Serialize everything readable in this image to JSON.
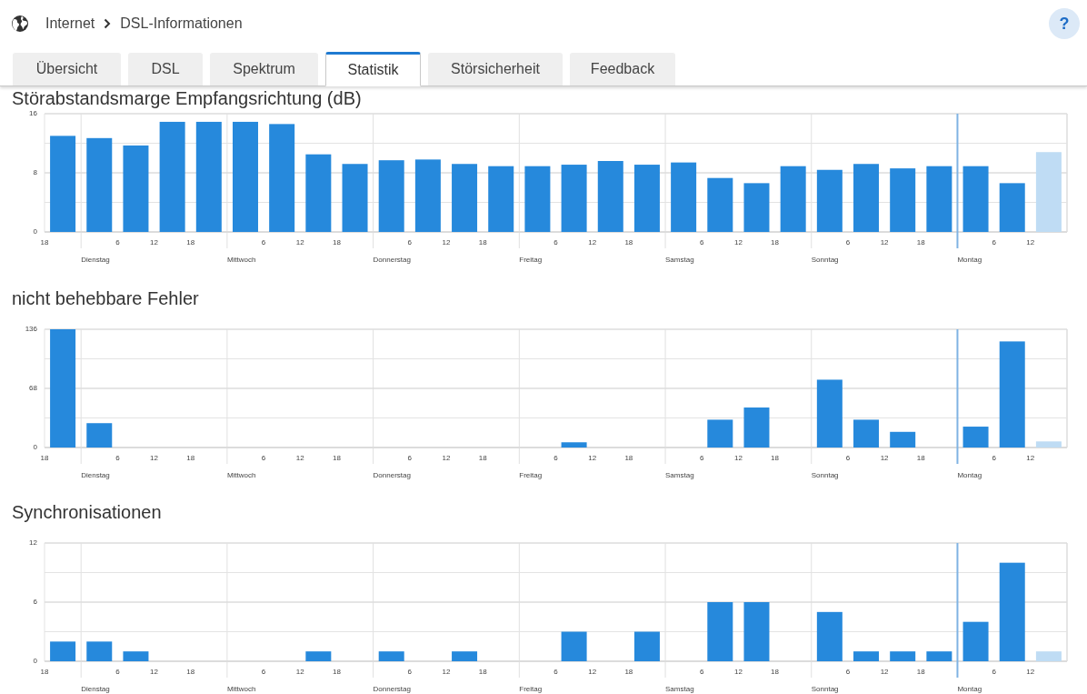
{
  "breadcrumb": [
    "Internet",
    "DSL-Informationen"
  ],
  "help": {
    "label": "?"
  },
  "tabs": [
    {
      "label": "Übersicht",
      "selected": false
    },
    {
      "label": "DSL",
      "selected": false
    },
    {
      "label": "Spektrum",
      "selected": false
    },
    {
      "label": "Statistik",
      "selected": true
    },
    {
      "label": "Störsicherheit",
      "selected": false
    },
    {
      "label": "Feedback",
      "selected": false
    }
  ],
  "charts": [
    {
      "title": "Störabstandsmarge Empfangsrichtung (dB)",
      "x_axis": {
        "hours": [
          "18",
          "6",
          "12",
          "18",
          "6",
          "12",
          "18",
          "6",
          "12",
          "18",
          "6",
          "12",
          "18",
          "6",
          "12",
          "18",
          "6",
          "12",
          "18",
          "6",
          "12"
        ],
        "days": [
          "Dienstag",
          "Mittwoch",
          "Donnerstag",
          "Freitag",
          "Samstag",
          "Sonntag",
          "Montag"
        ]
      },
      "chart_data": {
        "type": "bar",
        "stacked": true,
        "categories": [
          null,
          null,
          null,
          null,
          null,
          null,
          null,
          null,
          null,
          null,
          null,
          null,
          null,
          null,
          null,
          null,
          null,
          null,
          null,
          null,
          null,
          null,
          null,
          null,
          null,
          null,
          null,
          null
        ],
        "series": [
          {
            "color": "#2689dc",
            "values": [
              13.0,
              12.7,
              11.7,
              14.9,
              14.9,
              14.9,
              14.6,
              10.5,
              9.2,
              9.7,
              9.8,
              9.2,
              8.9,
              8.9,
              9.1,
              9.6,
              9.1,
              9.4,
              7.3,
              6.6,
              8.9,
              8.4,
              9.2,
              8.6,
              8.9,
              8.9,
              6.6,
              null
            ]
          },
          {
            "color": "#bfdcf4",
            "values": [
              null,
              null,
              null,
              null,
              null,
              null,
              null,
              null,
              null,
              null,
              null,
              null,
              null,
              null,
              null,
              null,
              null,
              null,
              null,
              null,
              null,
              null,
              null,
              null,
              null,
              null,
              null,
              10.8
            ]
          }
        ],
        "ylim": [
          0,
          16
        ],
        "yticks": [
          0,
          8,
          16
        ],
        "ref_lines": [
          {
            "axis": "y",
            "value": 4
          },
          {
            "axis": "y",
            "value": 8
          },
          {
            "axis": "y",
            "value": 12
          }
        ]
      }
    },
    {
      "title": "nicht behebbare Fehler",
      "x_axis": {
        "hours": [
          "18",
          "6",
          "12",
          "18",
          "6",
          "12",
          "18",
          "6",
          "12",
          "18",
          "6",
          "12",
          "18",
          "6",
          "12",
          "18",
          "6",
          "12",
          "18",
          "6",
          "12"
        ],
        "days": [
          "Dienstag",
          "Mittwoch",
          "Donnerstag",
          "Freitag",
          "Samstag",
          "Sonntag",
          "Montag"
        ]
      },
      "chart_data": {
        "type": "bar",
        "stacked": true,
        "categories": [
          null,
          null,
          null,
          null,
          null,
          null,
          null,
          null,
          null,
          null,
          null,
          null,
          null,
          null,
          null,
          null,
          null,
          null,
          null,
          null,
          null,
          null,
          null,
          null,
          null,
          null,
          null,
          null
        ],
        "series": [
          {
            "color": "#2689dc",
            "values": [
              136,
              28,
              0,
              0,
              0,
              0,
              0,
              0,
              0,
              0,
              0,
              0,
              0,
              0,
              6,
              0,
              0,
              0,
              32,
              46,
              0,
              78,
              32,
              18,
              0,
              24,
              122,
              null
            ]
          },
          {
            "color": "#bfdcf4",
            "values": [
              null,
              null,
              null,
              null,
              null,
              null,
              null,
              null,
              null,
              null,
              null,
              null,
              null,
              null,
              null,
              null,
              null,
              null,
              null,
              null,
              null,
              null,
              null,
              null,
              null,
              null,
              null,
              7
            ]
          }
        ],
        "ylim": [
          0,
          136
        ],
        "yticks": [
          0,
          68,
          136
        ],
        "ref_lines": [
          {
            "axis": "y",
            "value": 34
          },
          {
            "axis": "y",
            "value": 68
          },
          {
            "axis": "y",
            "value": 102
          }
        ]
      }
    },
    {
      "title": "Synchronisationen",
      "x_axis": {
        "hours": [
          "18",
          "6",
          "12",
          "18",
          "6",
          "12",
          "18",
          "6",
          "12",
          "18",
          "6",
          "12",
          "18",
          "6",
          "12",
          "18",
          "6",
          "12",
          "18",
          "6",
          "12"
        ],
        "days": [
          "Dienstag",
          "Mittwoch",
          "Donnerstag",
          "Freitag",
          "Samstag",
          "Sonntag",
          "Montag"
        ]
      },
      "chart_data": {
        "type": "bar",
        "stacked": true,
        "categories": [
          null,
          null,
          null,
          null,
          null,
          null,
          null,
          null,
          null,
          null,
          null,
          null,
          null,
          null,
          null,
          null,
          null,
          null,
          null,
          null,
          null,
          null,
          null,
          null,
          null,
          null,
          null,
          null
        ],
        "series": [
          {
            "color": "#2689dc",
            "values": [
              2,
              2,
              1,
              0,
              0,
              0,
              0,
              1,
              0,
              1,
              0,
              1,
              0,
              0,
              3,
              0,
              3,
              0,
              6,
              6,
              0,
              5,
              1,
              1,
              1,
              4,
              10,
              null
            ]
          },
          {
            "color": "#bfdcf4",
            "values": [
              null,
              null,
              null,
              null,
              null,
              null,
              null,
              null,
              null,
              null,
              null,
              null,
              null,
              null,
              null,
              null,
              null,
              null,
              null,
              null,
              null,
              null,
              null,
              null,
              null,
              null,
              null,
              1
            ]
          }
        ],
        "ylim": [
          0,
          12
        ],
        "yticks": [
          0,
          6,
          12
        ],
        "ref_lines": [
          {
            "axis": "y",
            "value": 3
          },
          {
            "axis": "y",
            "value": 6
          },
          {
            "axis": "y",
            "value": 9
          }
        ]
      }
    }
  ]
}
